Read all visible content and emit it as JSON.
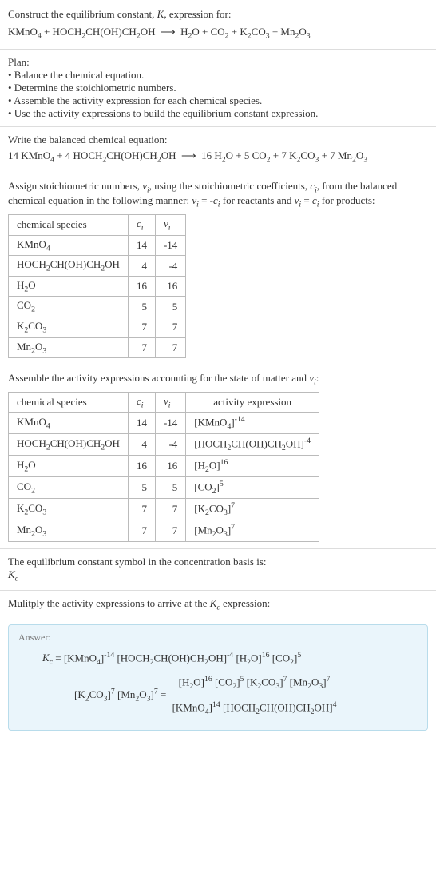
{
  "intro": {
    "line1": "Construct the equilibrium constant, K, expression for:",
    "equation": "KMnO₄ + HOCH₂CH(OH)CH₂OH ⟶ H₂O + CO₂ + K₂CO₃ + Mn₂O₃"
  },
  "plan": {
    "header": "Plan:",
    "b1": "• Balance the chemical equation.",
    "b2": "• Determine the stoichiometric numbers.",
    "b3": "• Assemble the activity expression for each chemical species.",
    "b4": "• Use the activity expressions to build the equilibrium constant expression."
  },
  "balanced": {
    "header": "Write the balanced chemical equation:",
    "equation": "14 KMnO₄ + 4 HOCH₂CH(OH)CH₂OH ⟶ 16 H₂O + 5 CO₂ + 7 K₂CO₃ + 7 Mn₂O₃"
  },
  "assign": {
    "text": "Assign stoichiometric numbers, νᵢ, using the stoichiometric coefficients, cᵢ, from the balanced chemical equation in the following manner: νᵢ = -cᵢ for reactants and νᵢ = cᵢ for products:"
  },
  "table1": {
    "h1": "chemical species",
    "h2": "cᵢ",
    "h3": "νᵢ",
    "rows": [
      {
        "s": "KMnO₄",
        "c": "14",
        "v": "-14"
      },
      {
        "s": "HOCH₂CH(OH)CH₂OH",
        "c": "4",
        "v": "-4"
      },
      {
        "s": "H₂O",
        "c": "16",
        "v": "16"
      },
      {
        "s": "CO₂",
        "c": "5",
        "v": "5"
      },
      {
        "s": "K₂CO₃",
        "c": "7",
        "v": "7"
      },
      {
        "s": "Mn₂O₃",
        "c": "7",
        "v": "7"
      }
    ]
  },
  "assemble": {
    "text": "Assemble the activity expressions accounting for the state of matter and νᵢ:"
  },
  "table2": {
    "h1": "chemical species",
    "h2": "cᵢ",
    "h3": "νᵢ",
    "h4": "activity expression",
    "rows": [
      {
        "s": "KMnO₄",
        "c": "14",
        "v": "-14",
        "a": "[KMnO₄]⁻¹⁴"
      },
      {
        "s": "HOCH₂CH(OH)CH₂OH",
        "c": "4",
        "v": "-4",
        "a": "[HOCH₂CH(OH)CH₂OH]⁻⁴"
      },
      {
        "s": "H₂O",
        "c": "16",
        "v": "16",
        "a": "[H₂O]¹⁶"
      },
      {
        "s": "CO₂",
        "c": "5",
        "v": "5",
        "a": "[CO₂]⁵"
      },
      {
        "s": "K₂CO₃",
        "c": "7",
        "v": "7",
        "a": "[K₂CO₃]⁷"
      },
      {
        "s": "Mn₂O₃",
        "c": "7",
        "v": "7",
        "a": "[Mn₂O₃]⁷"
      }
    ]
  },
  "symbol": {
    "line1": "The equilibrium constant symbol in the concentration basis is:",
    "line2": "K_c"
  },
  "multiply": {
    "text": "Mulitply the activity expressions to arrive at the K_c expression:"
  },
  "answer": {
    "label": "Answer:",
    "lhs": "K_c = ",
    "part1": "[KMnO₄]⁻¹⁴ [HOCH₂CH(OH)CH₂OH]⁻⁴ [H₂O]¹⁶ [CO₂]⁵",
    "part2a": "[K₂CO₃]⁷ [Mn₂O₃]⁷ = ",
    "frac_num": "[H₂O]¹⁶ [CO₂]⁵ [K₂CO₃]⁷ [Mn₂O₃]⁷",
    "frac_den": "[KMnO₄]¹⁴ [HOCH₂CH(OH)CH₂OH]⁴"
  },
  "chart_data": {
    "type": "table",
    "tables": [
      {
        "title": "stoichiometric numbers",
        "columns": [
          "chemical species",
          "c_i",
          "ν_i"
        ],
        "rows": [
          [
            "KMnO4",
            14,
            -14
          ],
          [
            "HOCH2CH(OH)CH2OH",
            4,
            -4
          ],
          [
            "H2O",
            16,
            16
          ],
          [
            "CO2",
            5,
            5
          ],
          [
            "K2CO3",
            7,
            7
          ],
          [
            "Mn2O3",
            7,
            7
          ]
        ]
      },
      {
        "title": "activity expressions",
        "columns": [
          "chemical species",
          "c_i",
          "ν_i",
          "activity expression"
        ],
        "rows": [
          [
            "KMnO4",
            14,
            -14,
            "[KMnO4]^-14"
          ],
          [
            "HOCH2CH(OH)CH2OH",
            4,
            -4,
            "[HOCH2CH(OH)CH2OH]^-4"
          ],
          [
            "H2O",
            16,
            16,
            "[H2O]^16"
          ],
          [
            "CO2",
            5,
            5,
            "[CO2]^5"
          ],
          [
            "K2CO3",
            7,
            7,
            "[K2CO3]^7"
          ],
          [
            "Mn2O3",
            7,
            7,
            "[Mn2O3]^7"
          ]
        ]
      }
    ]
  }
}
